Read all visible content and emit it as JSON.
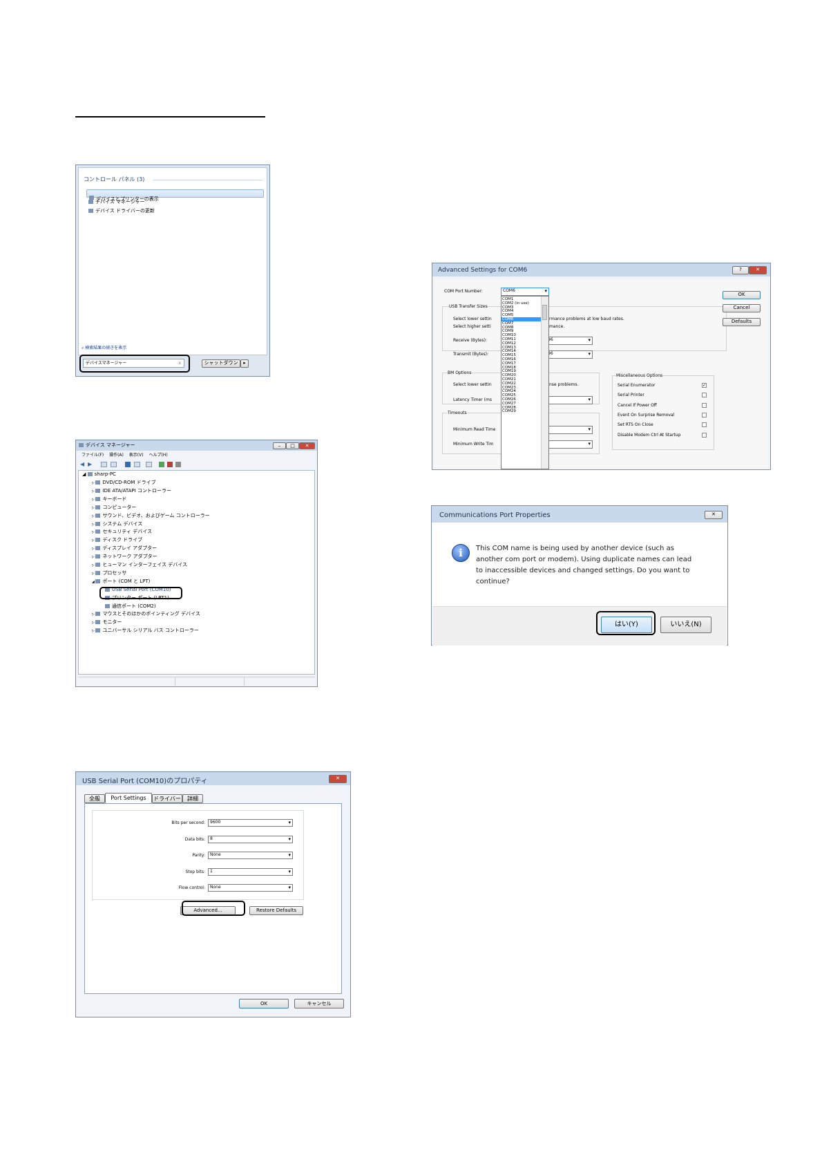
{
  "control_panel": {
    "group_title": "コントロール パネル (3)",
    "items": [
      "デバイスとプリンターの表示",
      "デバイス マネージャー",
      "デバイス ドライバーの更新"
    ],
    "see_more": "検索結果の続きを表示",
    "search_value": "デバイスマネージャー",
    "clear_glyph": "x",
    "shutdown_label": "シャットダウン",
    "shutdown_arrow": "▸"
  },
  "device_manager": {
    "title": "デバイス マネージャー",
    "menu": [
      "ファイル(F)",
      "操作(A)",
      "表示(V)",
      "ヘルプ(H)"
    ],
    "root": "sharp-PC",
    "nodes": [
      "DVD/CD-ROM ドライブ",
      "IDE ATA/ATAPI コントローラー",
      "キーボード",
      "コンピューター",
      "サウンド、ビデオ、およびゲーム コントローラー",
      "システム デバイス",
      "セキュリティ デバイス",
      "ディスク ドライブ",
      "ディスプレイ アダプター",
      "ネットワーク アダプター",
      "ヒューマン インターフェイス デバイス",
      "プロセッサ",
      "ポート (COM と LPT)"
    ],
    "port_children": [
      "USB Serial Port (COM10)",
      "プリンター ポート (LPT1)",
      "通信ポート (COM2)"
    ],
    "nodes_after": [
      "マウスとそのほかのポインティング デバイス",
      "モニター",
      "ユニバーサル シリアル バス コントローラー"
    ]
  },
  "port_properties": {
    "title": "USB Serial Port (COM10)のプロパティ",
    "tabs": [
      "全般",
      "Port Settings",
      "ドライバー",
      "詳細"
    ],
    "fields": [
      {
        "label": "Bits per second:",
        "value": "9600"
      },
      {
        "label": "Data bits:",
        "value": "8"
      },
      {
        "label": "Parity:",
        "value": "None"
      },
      {
        "label": "Stop bits:",
        "value": "1"
      },
      {
        "label": "Flow control:",
        "value": "None"
      }
    ],
    "advanced_label": "Advanced...",
    "restore_label": "Restore Defaults",
    "ok_label": "OK",
    "cancel_label": "キャンセル"
  },
  "advanced_settings": {
    "title": "Advanced Settings for COM6",
    "help_glyph": "?",
    "close_glyph": "✕",
    "com_port_label": "COM Port Number:",
    "com_port_value": "COM6",
    "usb_transfer_label": "USB Transfer Sizes",
    "select_lower": "Select lower settin",
    "select_higher": "Select higher setti",
    "perf_note_1": "rmance problems at low baud rates.",
    "perf_note_2": "mance.",
    "receive_label": "Receive (Bytes):",
    "receive_value": "96",
    "transmit_label": "Transmit (Bytes):",
    "transmit_value": "96",
    "bm_options_label": "BM Options",
    "bm_select_lower": "Select lower settin",
    "bm_note": "nse problems.",
    "latency_label": "Latency Timer (ms",
    "timeouts_label": "Timeouts",
    "min_read_label": "Minimum Read Time",
    "min_write_label": "Minimum Write Tim",
    "com_list": [
      "COM1",
      "COM2 (in use)",
      "COM3",
      "COM4",
      "COM5",
      "COM6",
      "COM7",
      "COM8",
      "COM9",
      "COM10",
      "COM11",
      "COM12",
      "COM13",
      "COM14",
      "COM15",
      "COM16",
      "COM17",
      "COM18",
      "COM19",
      "COM20",
      "COM21",
      "COM22",
      "COM23",
      "COM24",
      "COM25",
      "COM26",
      "COM27",
      "COM28",
      "COM29"
    ],
    "com_list_selected": "COM6",
    "ok_label": "OK",
    "cancel_label": "Cancel",
    "defaults_label": "Defaults",
    "misc_label": "Miscellaneous Options",
    "misc_options": [
      {
        "label": "Serial Enumerator",
        "checked": true
      },
      {
        "label": "Serial Printer",
        "checked": false
      },
      {
        "label": "Cancel If Power Off",
        "checked": false
      },
      {
        "label": "Event On Surprise Removal",
        "checked": false
      },
      {
        "label": "Set RTS On Close",
        "checked": false
      },
      {
        "label": "Disable Modem Ctrl At Startup",
        "checked": false
      }
    ]
  },
  "confirm_dialog": {
    "title": "Communications Port Properties",
    "close_glyph": "✕",
    "message_lines": [
      "This COM name is being used by another device (such as",
      "another com port or modem).  Using duplicate names can lead",
      "to inaccessible devices and changed settings.  Do you want to",
      "continue?"
    ],
    "yes_label": "はい(Y)",
    "no_label": "いいえ(N)"
  },
  "colors": {
    "accent": "#3399ff",
    "title_bar": "#c9d9ec",
    "frame": "#7a8ea8"
  }
}
